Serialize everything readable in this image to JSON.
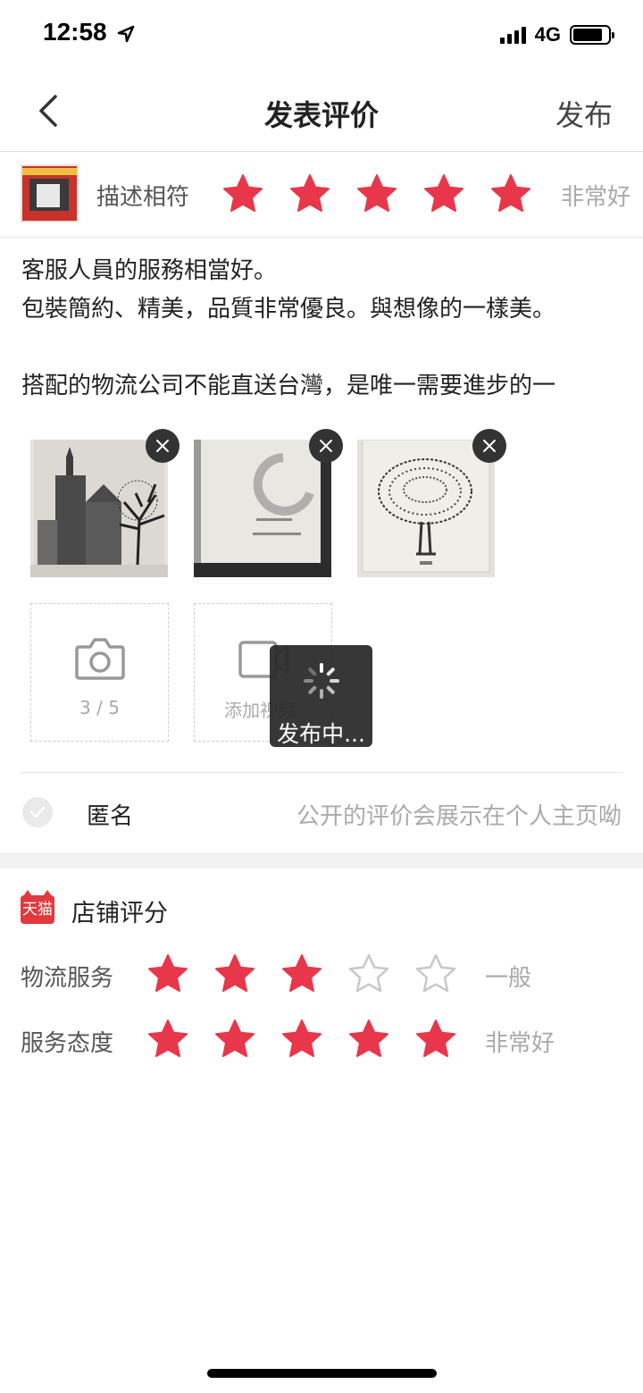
{
  "status_bar": {
    "time": "12:58",
    "location_icon": "location-arrow-icon",
    "network": "4G",
    "signal_bars": 4,
    "battery_level": 0.85
  },
  "nav": {
    "title": "发表评价",
    "publish": "发布",
    "back_icon": "chevron-left-icon"
  },
  "product_rating": {
    "label": "描述相符",
    "rating": 5,
    "max": 5,
    "text": "非常好"
  },
  "review": {
    "text": "客服人員的服務相當好。\n包裝簡約、精美，品質非常優良。與想像的一樣美。\n\n搭配的物流公司不能直送台灣，是唯一需要進步的一"
  },
  "photos": [
    {
      "name": "church-sketch-photo"
    },
    {
      "name": "ereader-screen-photo"
    },
    {
      "name": "tree-drawing-photo"
    }
  ],
  "add_photo": {
    "count": "3 / 5",
    "icon": "camera-icon"
  },
  "add_video": {
    "label": "添加视频",
    "icon": "video-icon"
  },
  "toast": {
    "text": "发布中..."
  },
  "anonymous": {
    "label": "匿名",
    "hint": "公开的评价会展示在个人主页呦",
    "checked": false
  },
  "shop": {
    "logo_text": "天猫",
    "title": "店铺评分",
    "items": [
      {
        "label": "物流服务",
        "rating": 3,
        "max": 5,
        "text": "一般"
      },
      {
        "label": "服务态度",
        "rating": 5,
        "max": 5,
        "text": "非常好"
      }
    ]
  },
  "colors": {
    "star_active": "#e8374a",
    "star_inactive": "#c8c8c8",
    "text_muted": "#aaaaaa",
    "brand": "#e4393c"
  }
}
